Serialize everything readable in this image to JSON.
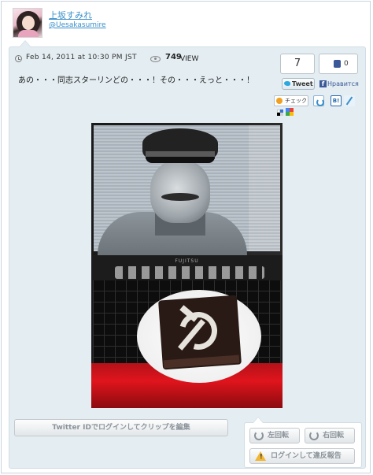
{
  "user": {
    "display_name": "上坂すみれ",
    "handle": "@Uesakasumire"
  },
  "post": {
    "timestamp": "Feb 14, 2011 at 10:30 PM JST",
    "view_count": "749",
    "view_label": "VIEW",
    "text": "あの・・・同志スターリンどの・・・！その・・・えっと・・・！"
  },
  "share": {
    "tweet_count": "7",
    "like_count": "0",
    "tweet_label": "Tweet",
    "facebook_label": "Нравится",
    "check_label": "チェック",
    "hatena_label": "B!"
  },
  "photo": {
    "laptop_brand": "FUJITSU"
  },
  "actions": {
    "clip_label": "Twitter IDでログインしてクリップを編集",
    "rotate_left_label": "左回転",
    "rotate_right_label": "右回転",
    "report_label": "ログインして違反報告"
  },
  "colors": {
    "link": "#3a8fc9",
    "panel_bg": "#e4edf2",
    "facebook": "#3b5998",
    "twitter": "#2aa9e0",
    "warning": "#f2b632"
  }
}
